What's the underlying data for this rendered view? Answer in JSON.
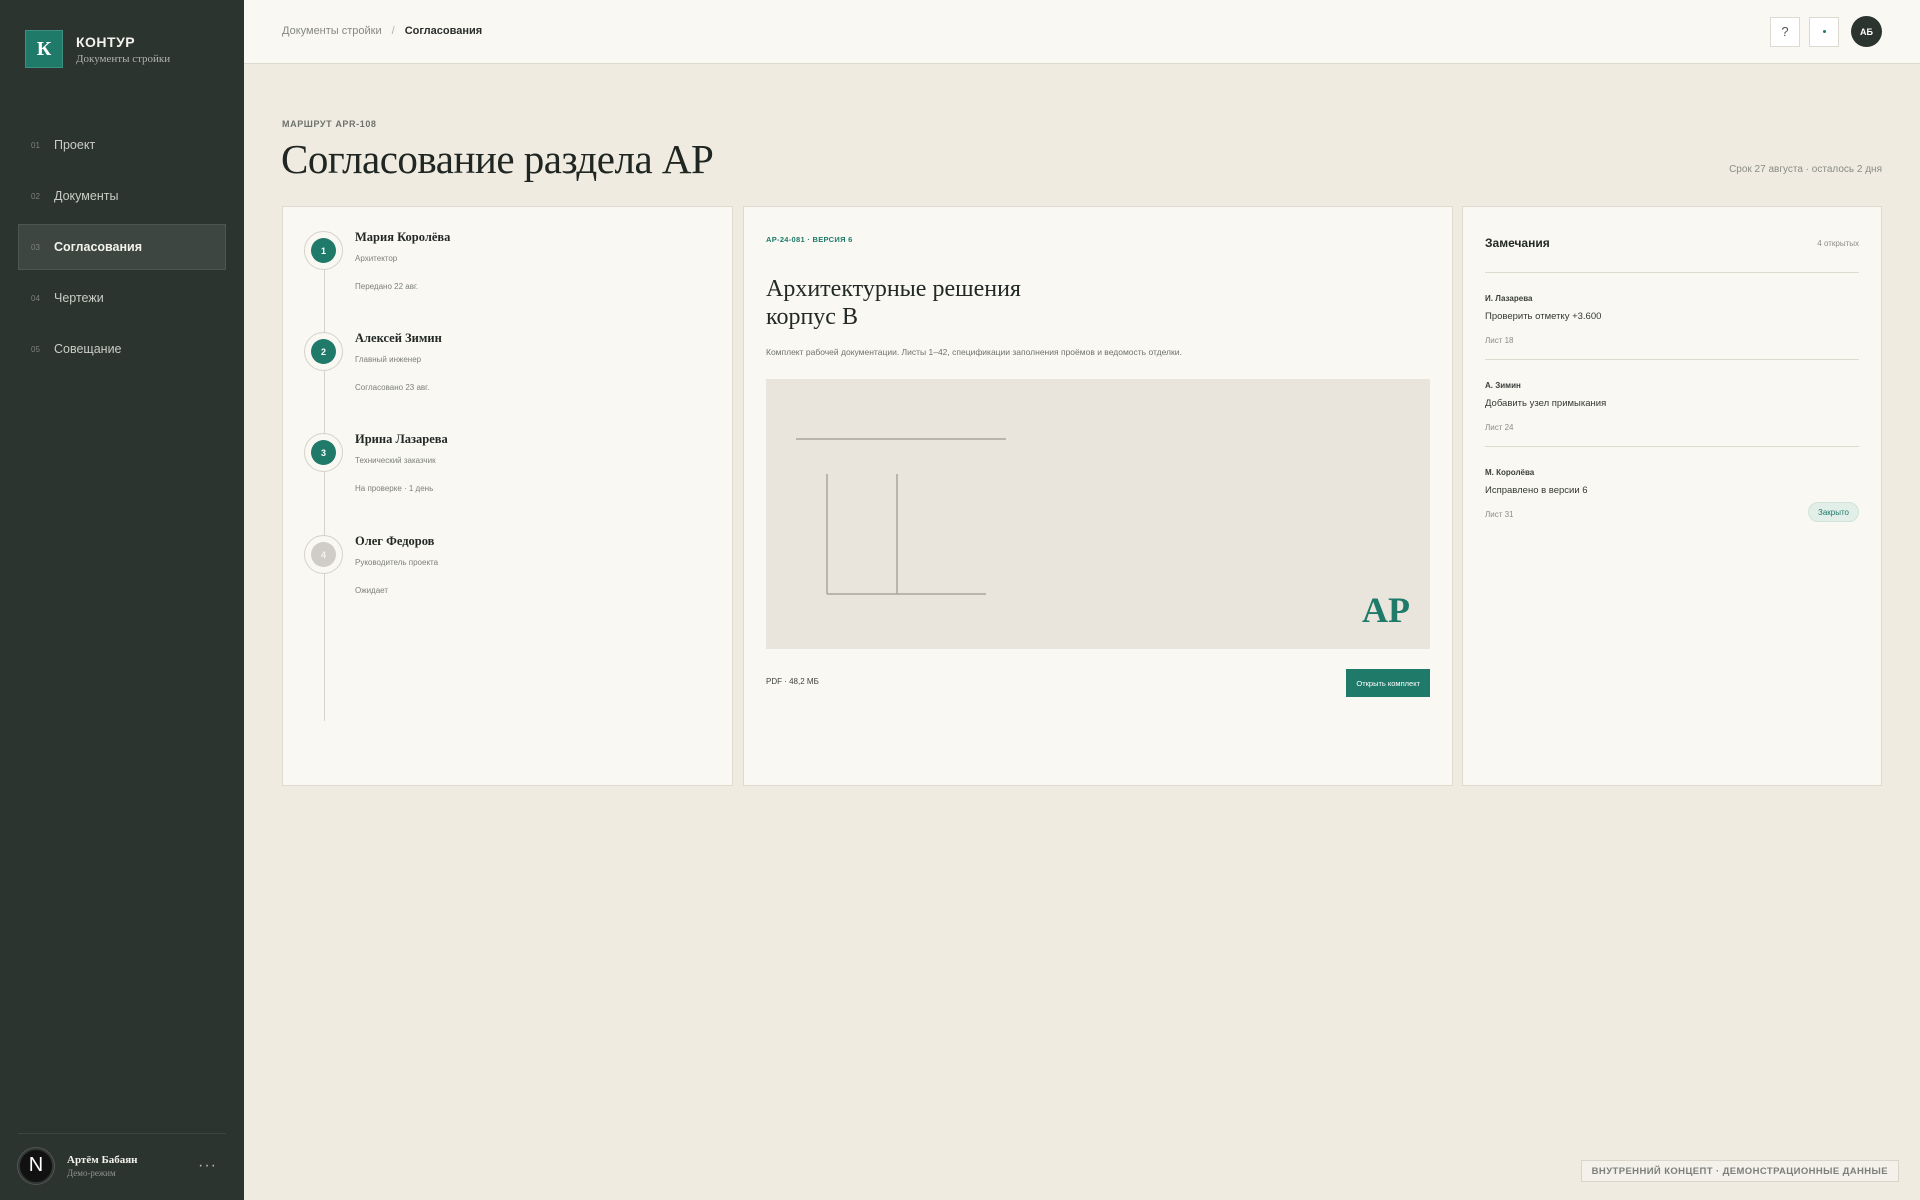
{
  "brand": {
    "logo_letter": "К",
    "name": "КОНТУР",
    "subtitle": "Документы стройки"
  },
  "nav": [
    {
      "num": "01",
      "label": "Проект",
      "active": false
    },
    {
      "num": "02",
      "label": "Документы",
      "active": false
    },
    {
      "num": "03",
      "label": "Согласования",
      "active": true
    },
    {
      "num": "04",
      "label": "Чертежи",
      "active": false
    },
    {
      "num": "05",
      "label": "Совещание",
      "active": false
    }
  ],
  "side_user": {
    "avatar_letter": "N",
    "name": "Артём Бабаян",
    "mode": "Демо-режим",
    "more": "···"
  },
  "breadcrumb": {
    "parent": "Документы стройки",
    "separator": "/",
    "current": "Согласования"
  },
  "top_actions": {
    "help": "?",
    "avatar_initials": "АБ"
  },
  "header": {
    "route_code": "МАРШРУТ APR-108",
    "title": "Согласование раздела АР",
    "deadline": "Срок 27 августа · осталось 2 дня"
  },
  "steps": [
    {
      "num": "1",
      "name": "Мария Королёва",
      "role": "Архитектор",
      "status": "Передано 22 авг.",
      "state": "done"
    },
    {
      "num": "2",
      "name": "Алексей Зимин",
      "role": "Главный инженер",
      "status": "Согласовано 23 авг.",
      "state": "done"
    },
    {
      "num": "3",
      "name": "Ирина Лазарева",
      "role": "Технический заказчик",
      "status": "На проверке · 1 день",
      "state": "current"
    },
    {
      "num": "4",
      "name": "Олег Федоров",
      "role": "Руководитель проекта",
      "status": "Ожидает",
      "state": "pending"
    }
  ],
  "document": {
    "code": "АР-24-081 · ВЕРСИЯ 6",
    "title_line1": "Архитектурные решения",
    "title_line2": "корпус В",
    "description": "Комплект рабочей документации. Листы 1–42, спецификации заполнения проёмов и ведомость отделки.",
    "preview_mark": "АР",
    "meta": "PDF · 48,2 МБ",
    "open_label": "Открыть комплект"
  },
  "notes": {
    "title": "Замечания",
    "count": "4 открытых",
    "items": [
      {
        "author": "И. Лазарева",
        "text": "Проверить отметку +3.600",
        "sheet": "Лист 18",
        "badge": ""
      },
      {
        "author": "А. Зимин",
        "text": "Добавить узел примыкания",
        "sheet": "Лист 24",
        "badge": ""
      },
      {
        "author": "М. Королёва",
        "text": "Исправлено в версии 6",
        "sheet": "Лист 31",
        "badge": "Закрыто"
      }
    ]
  },
  "footer_tag": "ВНУТРЕННИЙ КОНЦЕПТ · ДЕМОНСТРАЦИОННЫЕ ДАННЫЕ",
  "colors": {
    "accent": "#1f7a6a",
    "sidebar": "#2c3430",
    "background": "#efebe1",
    "card": "#faf8f3"
  }
}
